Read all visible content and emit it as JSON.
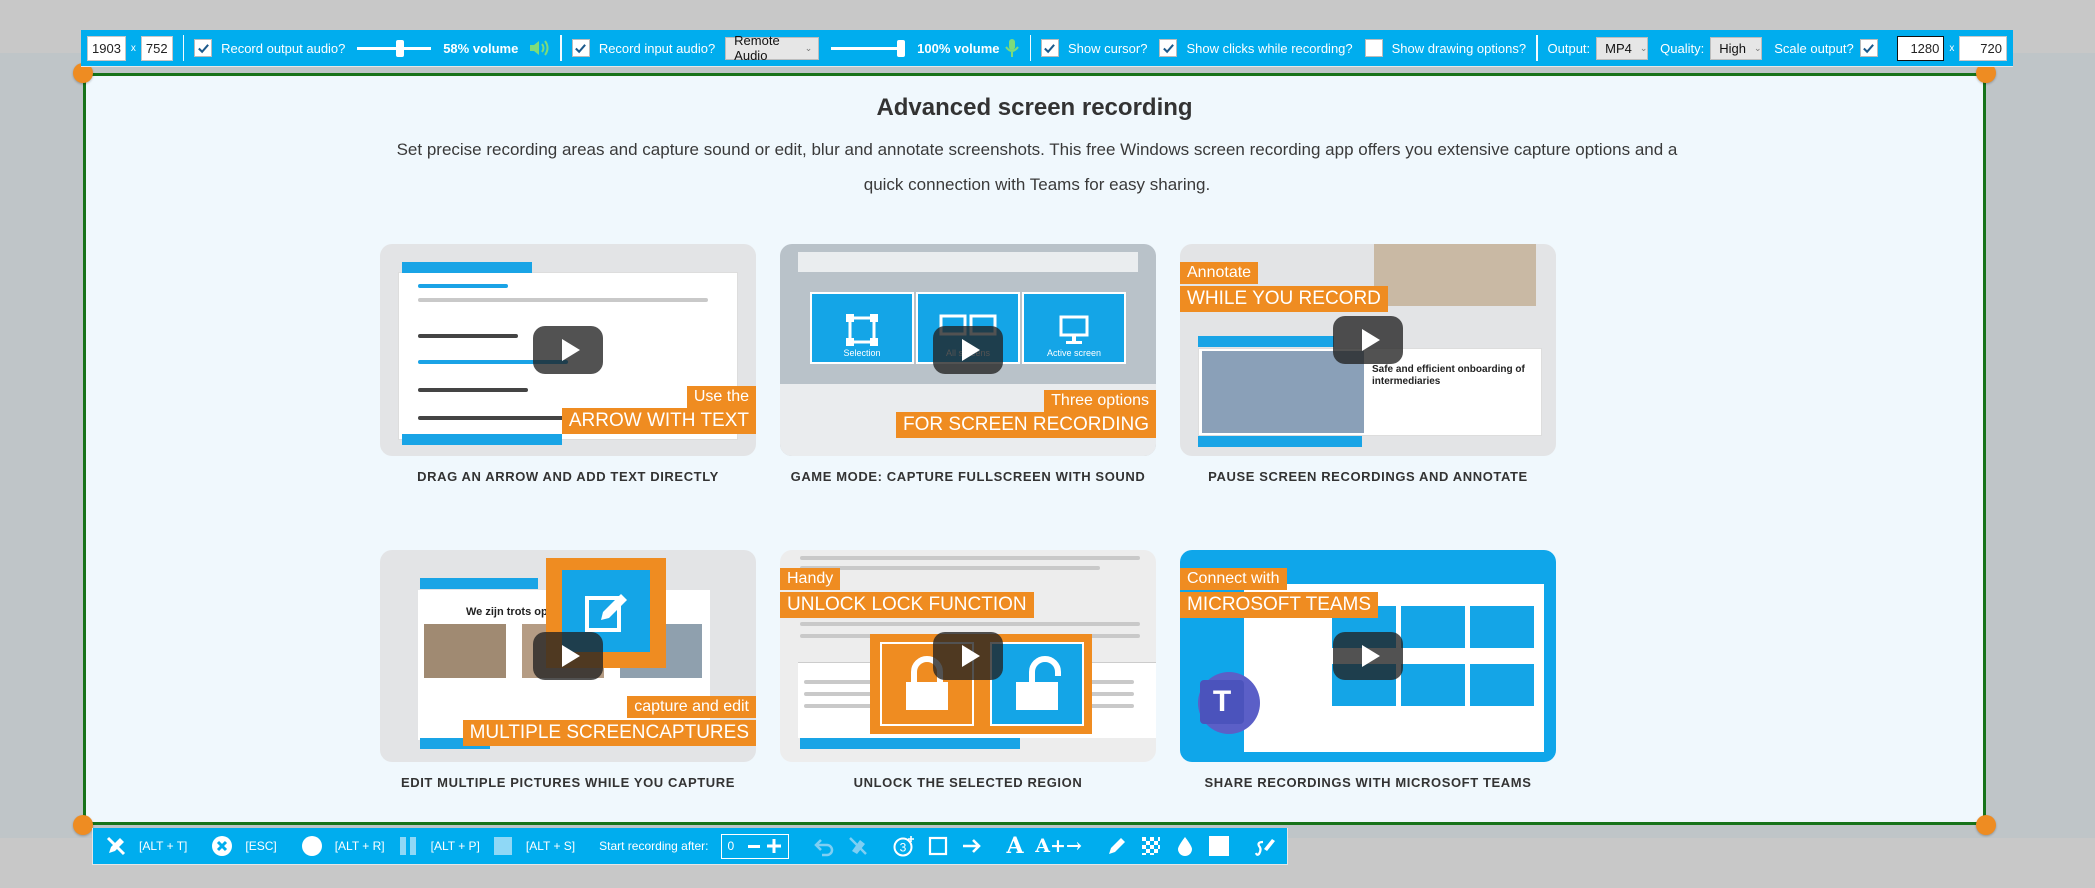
{
  "top_toolbar": {
    "width": "1903",
    "height": "752",
    "dimension_separator": "x",
    "record_output_audio": {
      "label": "Record output audio?",
      "checked": true,
      "volume_percent": 58,
      "volume_label": "58% volume"
    },
    "record_input_audio": {
      "label": "Record input audio?",
      "checked": true,
      "device": "Remote Audio",
      "volume_percent": 100,
      "volume_label": "100% volume"
    },
    "show_cursor": {
      "label": "Show cursor?",
      "checked": true
    },
    "show_clicks": {
      "label": "Show clicks while recording?",
      "checked": true
    },
    "show_drawing": {
      "label": "Show drawing options?",
      "checked": false
    },
    "output_label": "Output:",
    "output_value": "MP4",
    "quality_label": "Quality:",
    "quality_value": "High",
    "scale_label": "Scale output?",
    "scale_checked": true,
    "scale_width": "1280",
    "scale_height": "720"
  },
  "content": {
    "title": "Advanced screen recording",
    "description": "Set precise recording areas and capture sound or edit, blur and annotate screenshots. This free Windows screen recording app offers you extensive capture options and a quick connection with Teams for easy sharing.",
    "videos": [
      {
        "caption": "DRAG AN ARROW AND ADD TEXT DIRECTLY",
        "tag_small": "Use the",
        "tag_big": "ARROW WITH TEXT"
      },
      {
        "caption": "GAME MODE: CAPTURE FULLSCREEN WITH SOUND",
        "tag_small": "Three options",
        "tag_big": "FOR SCREEN RECORDING",
        "tiles": [
          "Selection",
          "All screens",
          "Active screen"
        ]
      },
      {
        "caption": "PAUSE SCREEN RECORDINGS AND ANNOTATE",
        "tag_small": "Annotate",
        "tag_big": "WHILE YOU RECORD",
        "inner_heading": "Safe and efficient onboarding of intermediaries"
      },
      {
        "caption": "EDIT MULTIPLE PICTURES WHILE YOU CAPTURE",
        "tag_small": "capture and edit",
        "tag_big": "MULTIPLE SCREENCAPTURES",
        "inner_heading": "We zijn trots op o"
      },
      {
        "caption": "UNLOCK THE SELECTED REGION",
        "tag_small": "Handy",
        "tag_big": "UNLOCK LOCK FUNCTION"
      },
      {
        "caption": "SHARE RECORDINGS WITH MICROSOFT TEAMS",
        "tag_small": "Connect with",
        "tag_big": "MICROSOFT TEAMS"
      }
    ]
  },
  "bottom_toolbar": {
    "toggle_tools_shortcut": "[ALT + T]",
    "close_shortcut": "[ESC]",
    "record_shortcut": "[ALT + R]",
    "pause_shortcut": "[ALT + P]",
    "stop_shortcut": "[ALT + S]",
    "start_after_label": "Start recording after:",
    "start_after_value": "0",
    "text_tool_label": "A",
    "text_arrow_tool_label": "A+→"
  }
}
